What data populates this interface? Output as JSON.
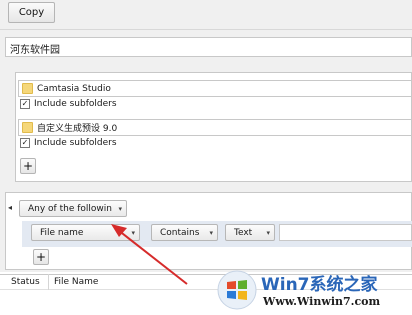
{
  "toolbar": {
    "copy_label": "Copy"
  },
  "search": {
    "value": "河东软件园"
  },
  "folders": [
    {
      "name": "Camtasia Studio",
      "include_label": "Include subfolders",
      "checked": true
    },
    {
      "name": "自定义生成预设 9.0",
      "include_label": "Include subfolders",
      "checked": true
    }
  ],
  "add_label": "+",
  "filter": {
    "group_mode": "Any of the followin",
    "field": "File name",
    "operator": "Contains",
    "type": "Text",
    "value": "",
    "expand_glyph": "◂"
  },
  "results": {
    "columns": [
      "Status",
      "File Name"
    ]
  },
  "watermark": {
    "brand": "Win7系统之家",
    "url": "Www.Winwin7.com"
  },
  "colors": {
    "arrow": "#d62b2b"
  }
}
